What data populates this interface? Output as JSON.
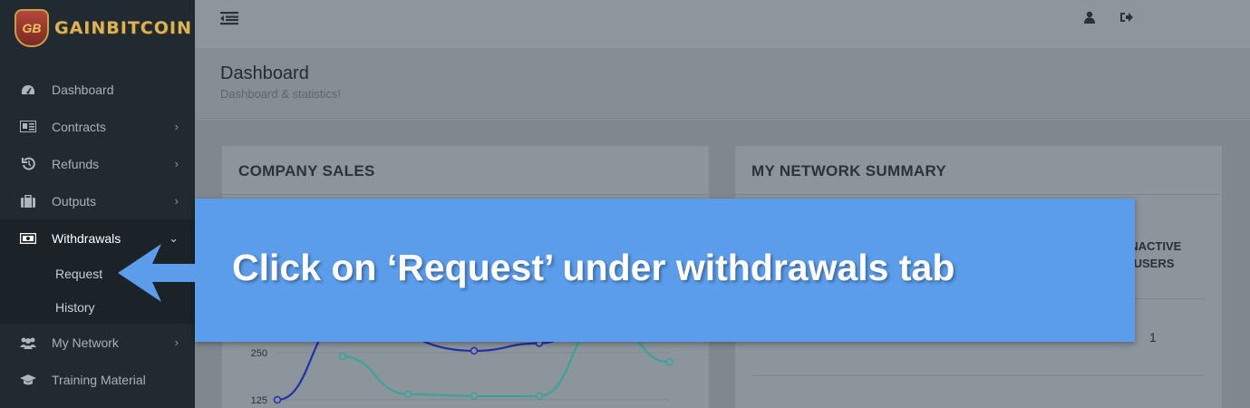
{
  "brand": {
    "logo_initials": "GB",
    "name": "GAINBITCOIN"
  },
  "sidebar": {
    "items": [
      {
        "label": "Dashboard",
        "icon": "dashboard-icon",
        "chevron": ""
      },
      {
        "label": "Contracts",
        "icon": "contracts-icon",
        "chevron": "›"
      },
      {
        "label": "Refunds",
        "icon": "refunds-icon",
        "chevron": "›"
      },
      {
        "label": "Outputs",
        "icon": "briefcase-icon",
        "chevron": "›"
      },
      {
        "label": "Withdrawals",
        "icon": "money-icon",
        "chevron": "⌄"
      },
      {
        "label": "My Network",
        "icon": "users-icon",
        "chevron": "›"
      },
      {
        "label": "Training Material",
        "icon": "graduation-cap-icon",
        "chevron": ""
      }
    ],
    "withdrawals_sub": [
      "Request",
      "History"
    ]
  },
  "header": {
    "title": "Dashboard",
    "subtitle": "Dashboard & statistics!"
  },
  "panels": {
    "sales_title": "COMPANY SALES",
    "network_title": "MY NETWORK SUMMARY",
    "network_header": "INACTIVE USERS",
    "network_value": "1"
  },
  "chart_data": {
    "type": "line",
    "title": "COMPANY SALES",
    "y_ticks": [
      "250",
      "125"
    ],
    "series": [
      {
        "color": "#2230a8",
        "values": [
          125,
          430,
          255,
          275,
          430
        ]
      },
      {
        "color": "#3aa39a",
        "values": [
          240,
          140,
          135,
          135,
          430,
          225
        ]
      }
    ]
  },
  "overlay": {
    "instruction": "Click on ‘Request’ under withdrawals tab",
    "bg_color": "#5b9ceb"
  }
}
